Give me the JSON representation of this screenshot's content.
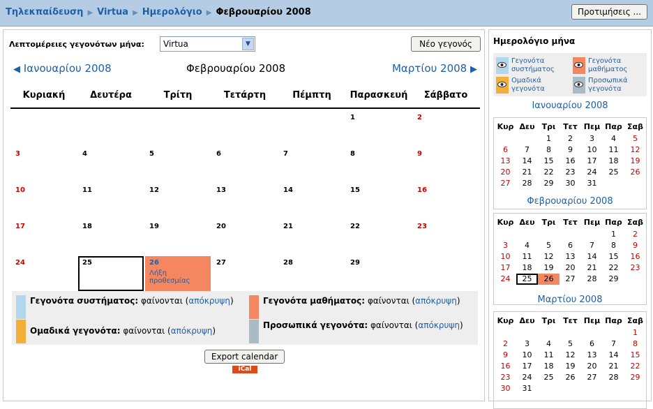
{
  "breadcrumb": [
    "Τηλεκπαίδευση",
    "Virtua",
    "Ημερολόγιο"
  ],
  "breadcrumb_current": "Φεβρουαρίου 2008",
  "preferences_button": "Προτιμήσεις ...",
  "main": {
    "details_label": "Λεπτομέρειες γεγονότων μήνα:",
    "course_select": "Virtua",
    "new_event_button": "Νέο γεγονός",
    "prev_month": "Ιανουαρίου 2008",
    "current_month": "Φεβρουαρίου 2008",
    "next_month": "Μαρτίου 2008",
    "weekdays": [
      "Κυριακή",
      "Δευτέρα",
      "Τρίτη",
      "Τετάρτη",
      "Πέμπτη",
      "Παρασκευή",
      "Σάββατο"
    ],
    "first_weekday": 5,
    "days_in_month": 29,
    "today": 25,
    "event_day": 26,
    "event_text": "Λήξη προθεσμίας",
    "export_button": "Export calendar",
    "ical": "iCal"
  },
  "legend": {
    "global": {
      "title": "Γεγονότα συστήματος:",
      "state": "φαίνονται",
      "action": "απόκρυψη"
    },
    "course": {
      "title": "Γεγονότα μαθήματος:",
      "state": "φαίνονται",
      "action": "απόκρυψη"
    },
    "group": {
      "title": "Ομαδικά γεγονότα:",
      "state": "φαίνονται",
      "action": "απόκρυψη"
    },
    "user": {
      "title": "Προσωπικά γεγονότα:",
      "state": "φαίνονται",
      "action": "απόκρυψη"
    }
  },
  "side": {
    "title": "Ημερολόγιο μήνα",
    "legend": [
      "Γεγονότα συστήματος",
      "Γεγονότα μαθήματος",
      "Ομαδικά γεγονότα",
      "Προσωπικά γεγονότα"
    ],
    "weekdays_short": [
      "Κυρ",
      "Δευ",
      "Τρι",
      "Τετ",
      "Πεμ",
      "Παρ",
      "Σαβ"
    ],
    "months": [
      {
        "title": "Ιανουαρίου 2008",
        "first_weekday": 2,
        "days": 31,
        "today": null,
        "event": null
      },
      {
        "title": "Φεβρουαρίου 2008",
        "first_weekday": 5,
        "days": 29,
        "today": 25,
        "event": 26
      },
      {
        "title": "Μαρτίου 2008",
        "first_weekday": 6,
        "days": 31,
        "today": null,
        "event": null
      }
    ]
  },
  "colors": {
    "global": "#b2d7ef",
    "course": "#f4875f",
    "group": "#f2b03b",
    "user": "#a9bcc5",
    "weekend": "#c80000",
    "link": "#1f5fa8"
  }
}
